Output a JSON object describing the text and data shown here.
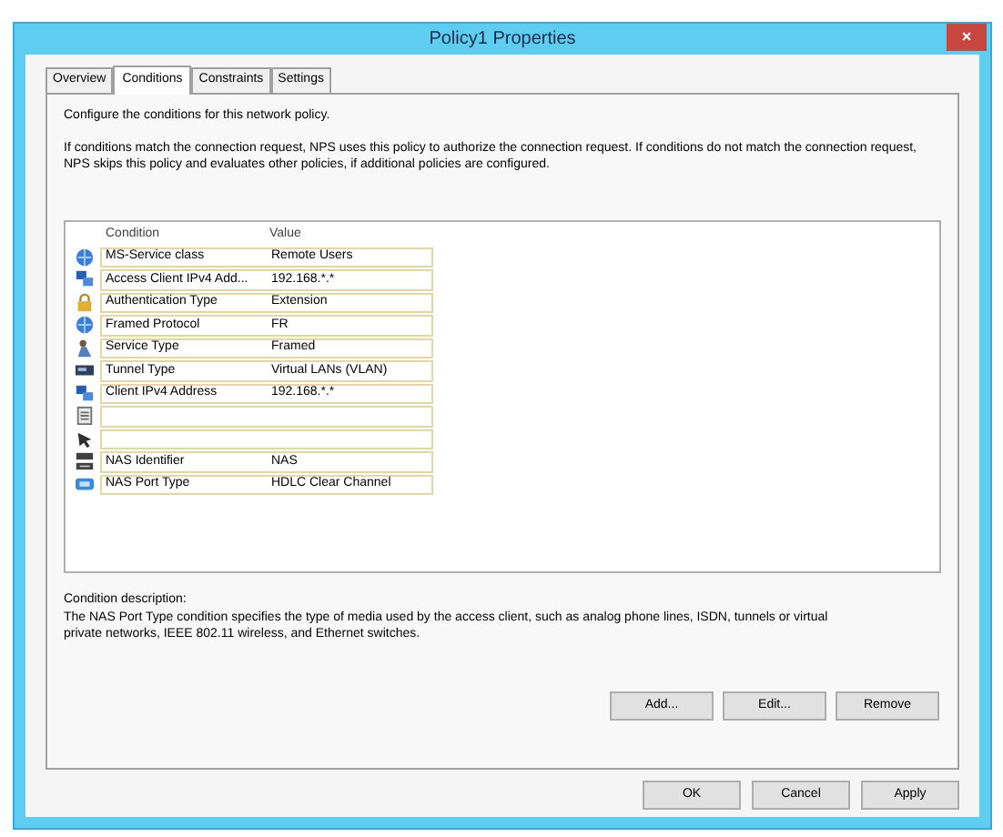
{
  "window": {
    "title": "Policy1 Properties",
    "close": "×"
  },
  "tabs": [
    {
      "label": "Overview",
      "selected": false
    },
    {
      "label": "Conditions",
      "selected": true
    },
    {
      "label": "Constraints",
      "selected": false
    },
    {
      "label": "Settings",
      "selected": false
    }
  ],
  "intro": "Configure the conditions for this network policy.",
  "explanation": "If conditions match the connection request, NPS uses this policy to authorize the connection request. If conditions do not match the connection request, NPS skips this policy and evaluates other policies, if additional policies are configured.",
  "table": {
    "columns": [
      "Condition",
      "Value"
    ],
    "rows": [
      {
        "kind": "globe",
        "condition": "MS-Service class",
        "value": "Remote Users"
      },
      {
        "kind": "computers",
        "condition": "Access Client IPv4 Add...",
        "value": "192.168.*.*"
      },
      {
        "kind": "lock",
        "condition": "Authentication Type",
        "value": "Extension"
      },
      {
        "kind": "globe",
        "condition": "Framed Protocol",
        "value": "FR"
      },
      {
        "kind": "person",
        "condition": "Service Type",
        "value": "Framed"
      },
      {
        "kind": "card",
        "condition": "Tunnel Type",
        "value": "Virtual LANs (VLAN)"
      },
      {
        "kind": "computers",
        "condition": "Client IPv4 Address",
        "value": "192.168.*.*"
      },
      {
        "kind": "document"
      },
      {
        "kind": "arrow"
      },
      {
        "kind": "server",
        "condition": "NAS Identifier",
        "value": "NAS"
      },
      {
        "kind": "plug",
        "condition": "NAS Port Type",
        "value": "HDLC Clear Channel"
      }
    ]
  },
  "description_label": "Condition description:",
  "description": "The NAS Port Type condition specifies the type of media used by the access client, such as analog phone lines, ISDN, tunnels or virtual private networks, IEEE 802.11 wireless, and Ethernet switches.",
  "list_buttons": [
    "Add...",
    "Edit...",
    "Remove"
  ],
  "dialog_buttons": [
    "OK",
    "Cancel",
    "Apply"
  ]
}
